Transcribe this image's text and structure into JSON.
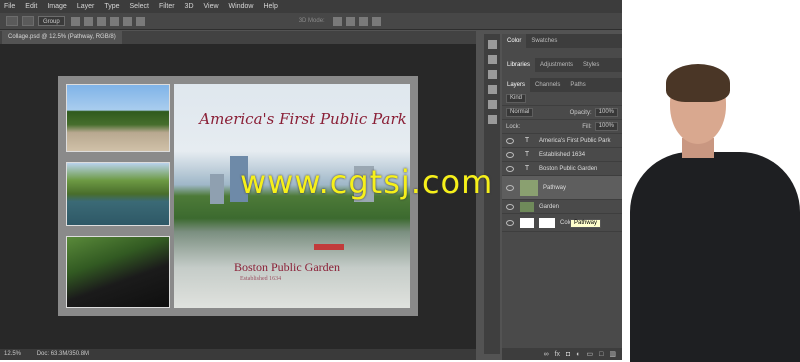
{
  "menu": [
    "File",
    "Edit",
    "Image",
    "Layer",
    "Type",
    "Select",
    "Filter",
    "3D",
    "View",
    "Window",
    "Help"
  ],
  "options_bar": {
    "auto_select": "Group",
    "mode_3d": "3D Mode:"
  },
  "document": {
    "tab_title": "Collage.psd @ 12.5% (Pathway, RGB/8)"
  },
  "canvas": {
    "headline": "America's First Public Park",
    "subtitle": "Boston Public Garden",
    "established": "Established 1634"
  },
  "watermark": "www.cgtsj.com",
  "status": {
    "zoom": "12.5%",
    "doc": "Doc: 63.3M/350.8M"
  },
  "panels": {
    "top_tabs": [
      "Color",
      "Swatches"
    ],
    "lib_tabs": [
      "Libraries",
      "Adjustments",
      "Styles"
    ],
    "layer_tabs": [
      "Layers",
      "Channels",
      "Paths"
    ],
    "filter_kind": "Kind",
    "blend_mode": "Normal",
    "opacity_label": "Opacity:",
    "opacity_value": "100%",
    "lock_label": "Lock:",
    "fill_label": "Fill:",
    "fill_value": "100%"
  },
  "layers": [
    {
      "name": "America's First Public Park",
      "kind": "T"
    },
    {
      "name": "Established 1634",
      "kind": "T"
    },
    {
      "name": "Boston Public Garden",
      "kind": "T"
    },
    {
      "name": "Pathway",
      "kind": "img"
    },
    {
      "name": "Garden",
      "kind": "img"
    },
    {
      "name": "Color Fill 1",
      "kind": "fill"
    }
  ],
  "tooltip": "Pathway",
  "bottom_icons": [
    "link-icon",
    "fx-icon",
    "mask-icon",
    "adjustment-icon",
    "folder-icon",
    "new-layer-icon",
    "trash-icon"
  ]
}
